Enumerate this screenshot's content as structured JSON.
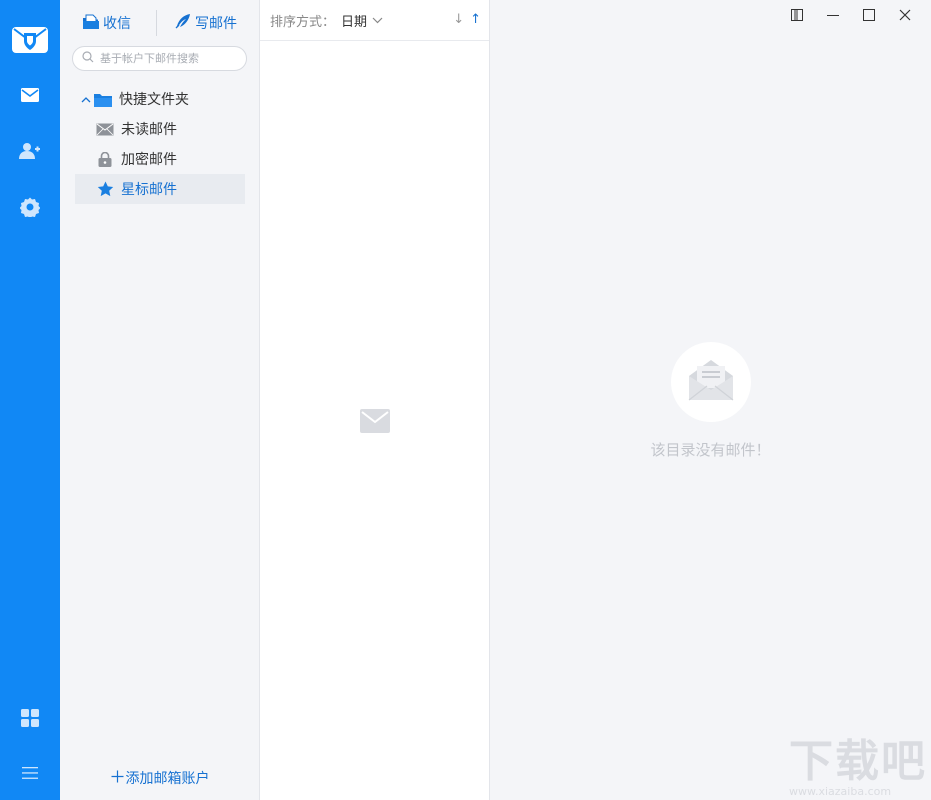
{
  "rail": {
    "icons": [
      "app-logo-icon",
      "mail-icon",
      "contacts-icon",
      "settings-icon",
      "apps-grid-icon",
      "menu-icon"
    ]
  },
  "toolbar": {
    "receive_label": "收信",
    "compose_label": "写邮件"
  },
  "search": {
    "placeholder": "基于帐户下邮件搜索"
  },
  "folders": {
    "group_label": "快捷文件夹",
    "items": [
      {
        "label": "未读邮件",
        "icon": "envelope-icon"
      },
      {
        "label": "加密邮件",
        "icon": "lock-icon"
      },
      {
        "label": "星标邮件",
        "icon": "star-icon",
        "selected": true
      }
    ]
  },
  "add_account_label": "添加邮箱账户",
  "list": {
    "sort_label": "排序方式：",
    "sort_value": "日期",
    "sort_asc": "↓",
    "sort_desc": "↑"
  },
  "reader": {
    "empty_text": "该目录没有邮件！"
  },
  "watermark": {
    "big": "下载吧",
    "small": "www.xiazaiba.com"
  },
  "colors": {
    "rail": "#1188f5",
    "accent": "#1671d1",
    "pane_bg": "#f4f5f8"
  }
}
